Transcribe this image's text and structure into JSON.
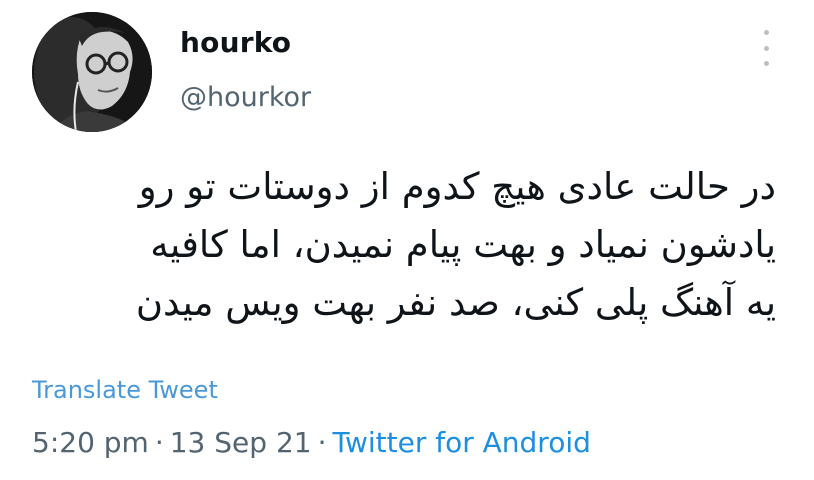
{
  "author": {
    "display_name": "hourko",
    "handle": "@hourkor"
  },
  "tweet": {
    "lines": [
      "در حالت عادی هیچ کدوم از دوستات تو رو",
      "یادشون نمیاد و بهت پیام نمیدن، اما کافیه",
      "یه آهنگ پلی کنی، صد نفر بهت ویس میدن"
    ],
    "translate_label": "Translate Tweet",
    "time": "5:20 pm",
    "separator": "·",
    "date": "13 Sep 21",
    "source": "Twitter for Android"
  },
  "icons": {
    "more": "more-vertical-icon"
  },
  "colors": {
    "text": "#0f1419",
    "secondary": "#536471",
    "link": "#1d8fe0",
    "translate": "#4a98d8"
  }
}
